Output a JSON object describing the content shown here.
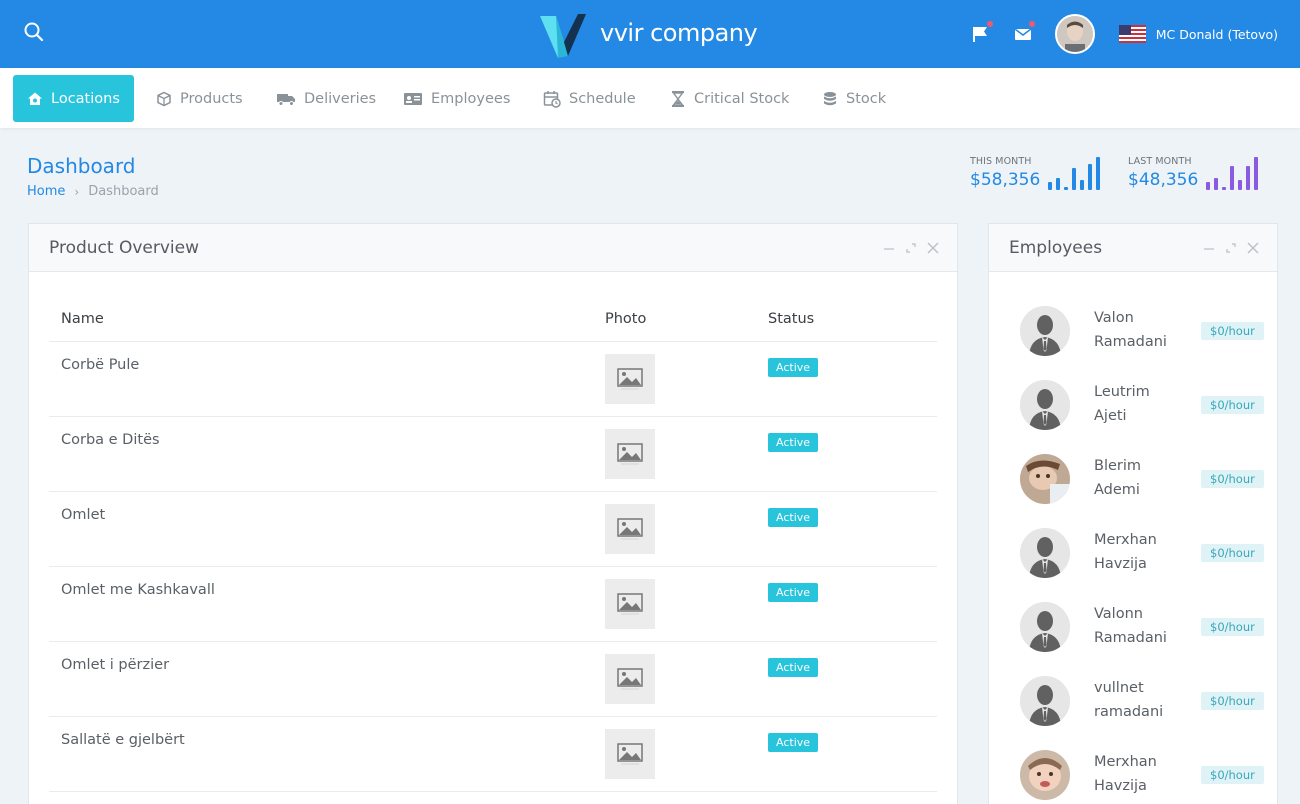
{
  "header": {
    "brand": "vvir company",
    "user_name": "MC Donald (Tetovo)",
    "colors": {
      "bar": "#2389e4",
      "accent": "#27c4dc",
      "notify_dot": "#f25a6b"
    }
  },
  "nav": {
    "items": [
      {
        "label": "Locations",
        "icon": "home-icon",
        "active": true
      },
      {
        "label": "Products",
        "icon": "cube-icon"
      },
      {
        "label": "Deliveries",
        "icon": "truck-icon"
      },
      {
        "label": "Employees",
        "icon": "id-card-icon"
      },
      {
        "label": "Schedule",
        "icon": "calendar-clock-icon"
      },
      {
        "label": "Critical Stock",
        "icon": "hourglass-icon"
      },
      {
        "label": "Stock",
        "icon": "database-icon"
      }
    ]
  },
  "page": {
    "title": "Dashboard",
    "breadcrumb": {
      "home": "Home",
      "current": "Dashboard"
    }
  },
  "stats": {
    "this_month": {
      "label": "THIS MONTH",
      "value": "$58,356",
      "color": "#2389e4"
    },
    "last_month": {
      "label": "LAST MONTH",
      "value": "$48,356",
      "color": "#8a5ae0"
    }
  },
  "product_overview": {
    "title": "Product Overview",
    "columns": {
      "name": "Name",
      "photo": "Photo",
      "status": "Status"
    },
    "rows": [
      {
        "name": "Corbë Pule",
        "status": "Active"
      },
      {
        "name": "Corba e Ditës",
        "status": "Active"
      },
      {
        "name": "Omlet",
        "status": "Active"
      },
      {
        "name": "Omlet me Kashkavall",
        "status": "Active"
      },
      {
        "name": "Omlet i përzier",
        "status": "Active"
      },
      {
        "name": "Sallatë e gjelbërt",
        "status": "Active"
      }
    ]
  },
  "employees": {
    "title": "Employees",
    "list": [
      {
        "first": "Valon",
        "last": "Ramadani",
        "rate": "$0/hour",
        "avatar": "placeholder"
      },
      {
        "first": "Leutrim",
        "last": "Ajeti",
        "rate": "$0/hour",
        "avatar": "placeholder"
      },
      {
        "first": "Blerim",
        "last": "Ademi",
        "rate": "$0/hour",
        "avatar": "photo"
      },
      {
        "first": "Merxhan",
        "last": "Havzija",
        "rate": "$0/hour",
        "avatar": "placeholder"
      },
      {
        "first": "Valonn",
        "last": "Ramadani",
        "rate": "$0/hour",
        "avatar": "placeholder"
      },
      {
        "first": "vullnet",
        "last": "ramadani",
        "rate": "$0/hour",
        "avatar": "placeholder"
      },
      {
        "first": "Merxhan",
        "last": "Havzija",
        "rate": "$0/hour",
        "avatar": "photo"
      }
    ]
  }
}
